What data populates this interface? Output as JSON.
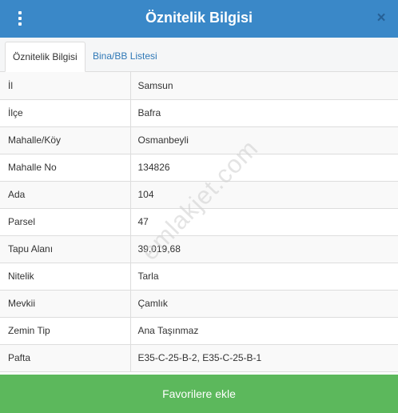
{
  "header": {
    "title": "Öznitelik Bilgisi",
    "menu_icon": "vertical-dots-icon",
    "close_label": "×",
    "color": "#3a88c8"
  },
  "tabs": [
    {
      "label": "Öznitelik Bilgisi",
      "active": true
    },
    {
      "label": "Bina/BB Listesi",
      "active": false
    }
  ],
  "rows": [
    {
      "key": "İl",
      "value": "Samsun"
    },
    {
      "key": "İlçe",
      "value": "Bafra"
    },
    {
      "key": "Mahalle/Köy",
      "value": "Osmanbeyli"
    },
    {
      "key": "Mahalle No",
      "value": "134826"
    },
    {
      "key": "Ada",
      "value": "104"
    },
    {
      "key": "Parsel",
      "value": "47"
    },
    {
      "key": "Tapu Alanı",
      "value": "39.019,68"
    },
    {
      "key": "Nitelik",
      "value": "Tarla"
    },
    {
      "key": "Mevkii",
      "value": "Çamlık"
    },
    {
      "key": "Zemin Tip",
      "value": "Ana Taşınmaz"
    },
    {
      "key": "Pafta",
      "value": "E35-C-25-B-2, E35-C-25-B-1"
    }
  ],
  "watermark": "emlakjet.com",
  "footer": {
    "button_label": "Favorilere ekle",
    "color": "#5cb85c"
  }
}
